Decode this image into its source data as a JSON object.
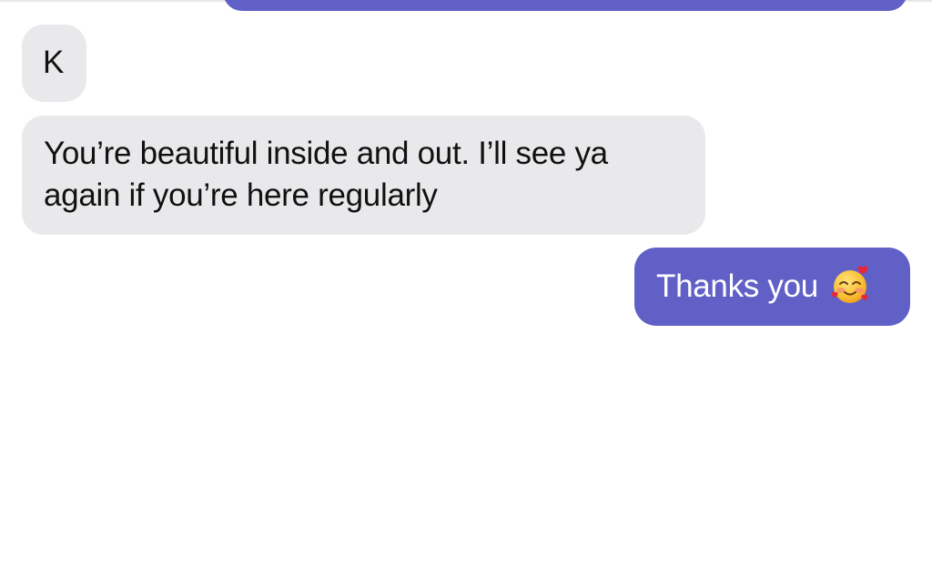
{
  "messages": [
    {
      "direction": "incoming",
      "text": "K"
    },
    {
      "direction": "incoming",
      "lines": [
        "You’re beautiful inside and out.  I’ll see ya",
        "again if you’re here regularly"
      ]
    },
    {
      "direction": "outgoing",
      "text": "Thanks you",
      "emoji": "smiling-face-with-hearts-icon"
    }
  ],
  "colors": {
    "outgoing_bubble": "#6160c7",
    "incoming_bubble": "#e9e9eb",
    "incoming_text": "#111111",
    "outgoing_text": "#ffffff",
    "background": "#ffffff"
  }
}
